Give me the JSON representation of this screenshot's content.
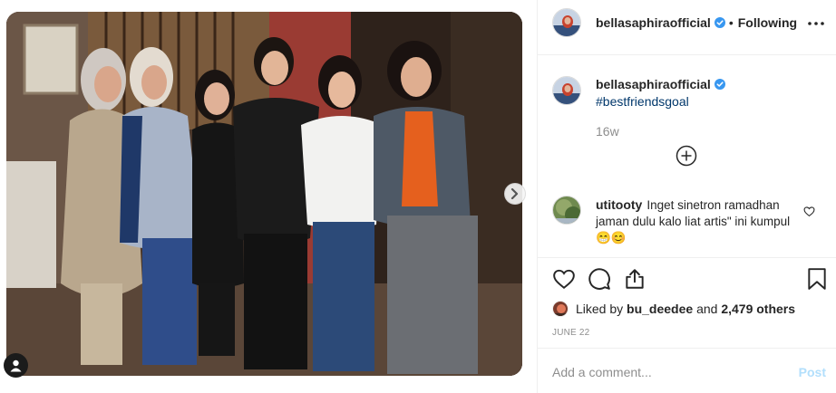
{
  "post": {
    "username": "bellasaphiraofficial",
    "follow_status": "Following",
    "caption_hashtag": "#bestfriendsgoal",
    "caption_age": "16w",
    "date": "JUNE 22"
  },
  "comments": [
    {
      "username": "utitooty",
      "text": "Inget sinetron ramadhan jaman dulu kalo liat artis\" ini kumpul 😁😊"
    }
  ],
  "likes": {
    "prefix": "Liked by",
    "user": "bu_deedee",
    "conjunction": "and",
    "others": "2,479 others"
  },
  "composer": {
    "placeholder": "Add a comment...",
    "post_label": "Post"
  },
  "carousel": {
    "total_slides": 2,
    "active_index": 0
  },
  "colors": {
    "link": "#00376b",
    "verified": "#3897f0",
    "muted": "#8e8e8e",
    "post_disabled": "#b2dffc"
  },
  "icons": [
    "verified-badge-icon",
    "more-options-icon",
    "load-more-comments-icon",
    "heart-icon",
    "comment-icon",
    "share-icon",
    "bookmark-icon",
    "chevron-right-icon",
    "user-tag-icon"
  ]
}
